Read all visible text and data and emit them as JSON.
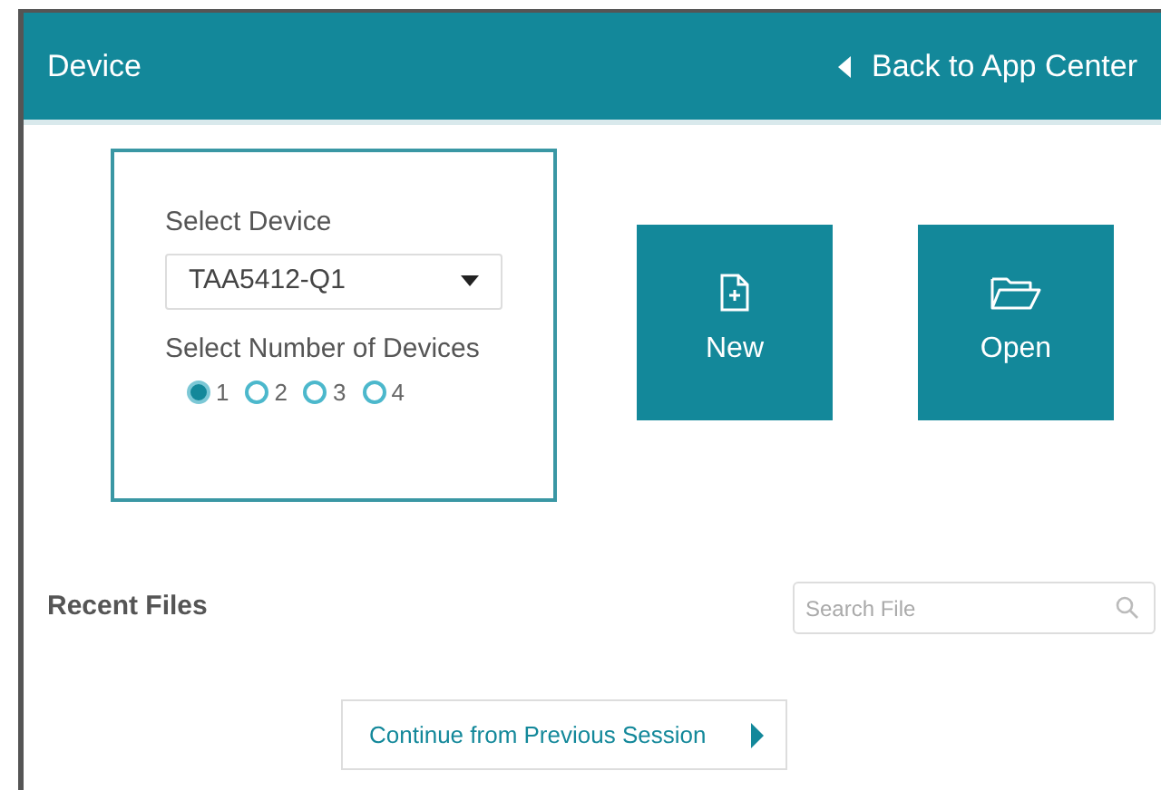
{
  "header": {
    "title": "Device",
    "back_link": "Back to App Center"
  },
  "device_card": {
    "select_label": "Select Device",
    "select_value": "TAA5412-Q1",
    "count_label": "Select Number of Devices",
    "count_options": [
      {
        "label": "1",
        "selected": true
      },
      {
        "label": "2",
        "selected": false
      },
      {
        "label": "3",
        "selected": false
      },
      {
        "label": "4",
        "selected": false
      }
    ]
  },
  "actions": [
    {
      "kind": "new",
      "label": "New"
    },
    {
      "kind": "open",
      "label": "Open"
    }
  ],
  "recent_files": {
    "title": "Recent Files",
    "search": {
      "placeholder": "Search File"
    }
  },
  "continue_button": "Continue from Previous Session"
}
